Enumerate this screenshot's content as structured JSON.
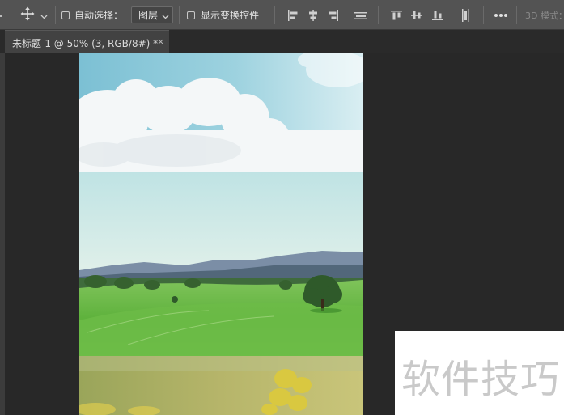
{
  "toolbar": {
    "tool_icon": "move-tool-icon",
    "auto_select_label": "自动选择：",
    "auto_select_checked": false,
    "auto_select_target": "图层",
    "show_transform_label": "显示变换控件",
    "show_transform_checked": false,
    "align_icons": [
      "align-left-icon",
      "align-horizontal-center-icon",
      "align-right-icon",
      "distribute-horizontal-icon",
      "align-top-icon",
      "align-vertical-center-icon",
      "align-bottom-icon",
      "distribute-vertical-icon"
    ],
    "more_icon": "more-options-icon",
    "mode_3d_label": "3D 模式："
  },
  "document": {
    "tab_title": "未标题-1 @ 50% (3, RGB/8#) *",
    "close_glyph": "×"
  },
  "canvas": {
    "layers": [
      "sky-clouds-photo",
      "green-hills-landscape-photo",
      "yellow-flower-photo"
    ]
  },
  "watermark": {
    "text": "软件技巧"
  }
}
